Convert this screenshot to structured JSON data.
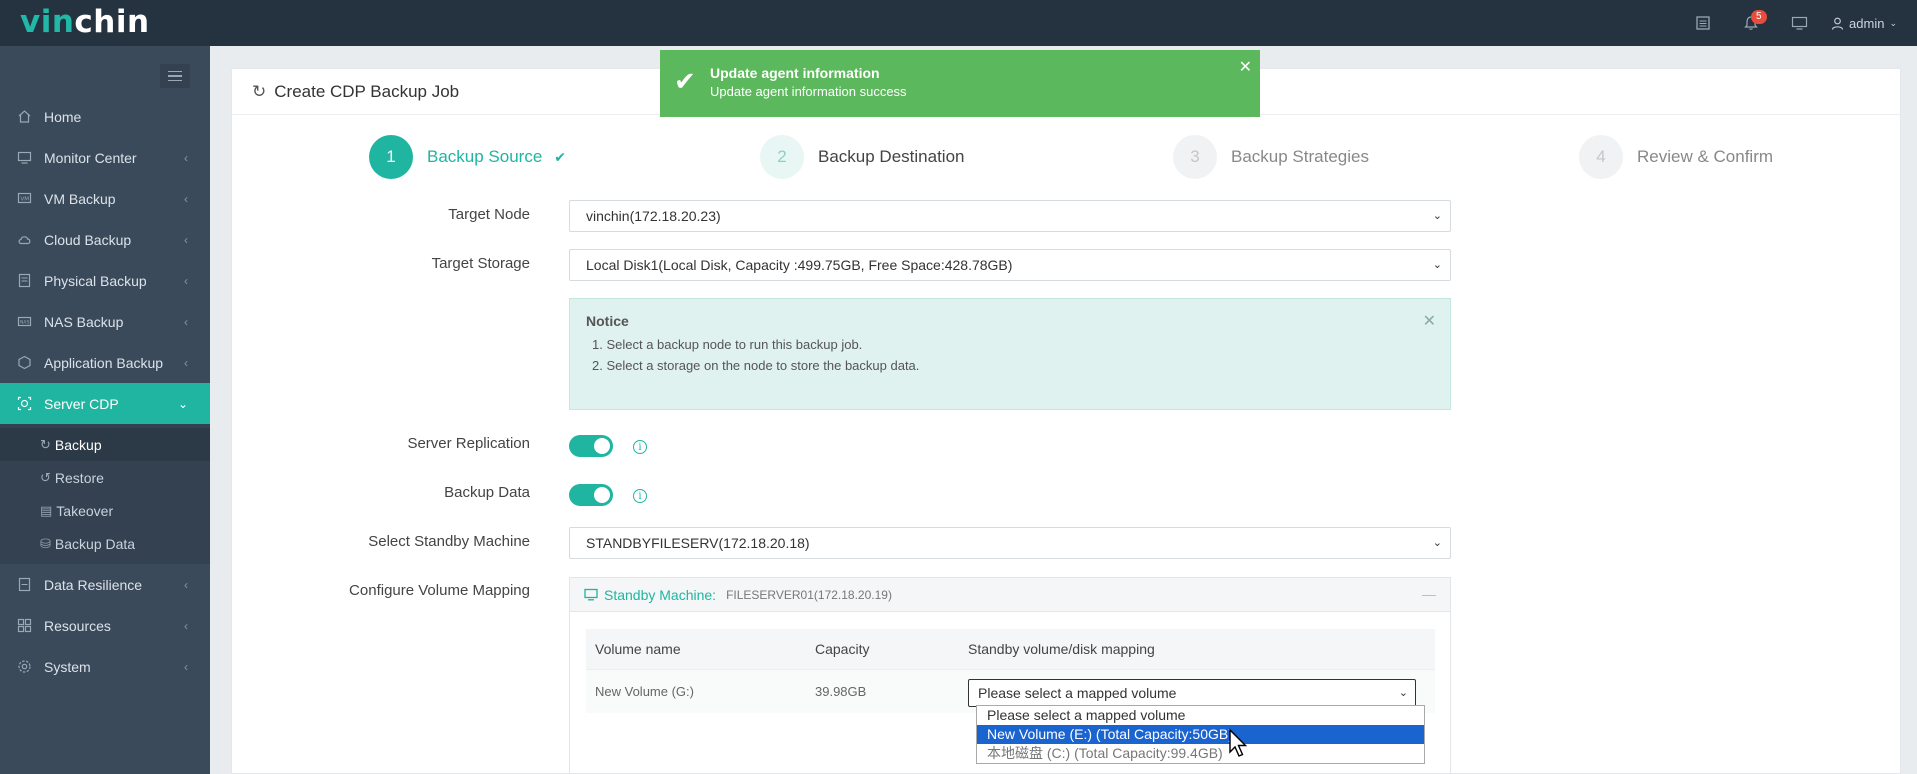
{
  "app": {
    "logo_prefix": "vin",
    "logo_suffix": "chin",
    "notification_count": "5",
    "user": "admin"
  },
  "sidebar": {
    "items": [
      {
        "label": "Home",
        "icon": "home-icon"
      },
      {
        "label": "Monitor Center",
        "icon": "monitor-icon"
      },
      {
        "label": "VM Backup",
        "icon": "vm-icon"
      },
      {
        "label": "Cloud Backup",
        "icon": "cloud-icon"
      },
      {
        "label": "Physical Backup",
        "icon": "physical-icon"
      },
      {
        "label": "NAS Backup",
        "icon": "nas-icon"
      },
      {
        "label": "Application Backup",
        "icon": "app-icon"
      },
      {
        "label": "Server CDP",
        "icon": "cdp-icon"
      },
      {
        "label": "Data Resilience",
        "icon": "resilience-icon"
      },
      {
        "label": "Resources",
        "icon": "resources-icon"
      },
      {
        "label": "System",
        "icon": "gear-icon"
      }
    ],
    "submenu": [
      {
        "label": "Backup"
      },
      {
        "label": "Restore"
      },
      {
        "label": "Takeover"
      },
      {
        "label": "Backup Data"
      }
    ]
  },
  "page": {
    "title": "Create CDP Backup Job"
  },
  "steps": [
    {
      "num": "1",
      "label": "Backup Source",
      "state": "done"
    },
    {
      "num": "2",
      "label": "Backup Destination",
      "state": "next"
    },
    {
      "num": "3",
      "label": "Backup Strategies",
      "state": "pending"
    },
    {
      "num": "4",
      "label": "Review & Confirm",
      "state": "pending"
    }
  ],
  "form": {
    "target_node_label": "Target Node",
    "target_node_value": "vinchin(172.18.20.23)",
    "target_storage_label": "Target Storage",
    "target_storage_value": "Local Disk1(Local Disk, Capacity :499.75GB, Free Space:428.78GB)",
    "notice_title": "Notice",
    "notice_lines": [
      "1. Select a backup node to run this backup job.",
      "2. Select a storage on the node to store the backup data."
    ],
    "server_replication_label": "Server Replication",
    "server_replication_on": true,
    "backup_data_label": "Backup Data",
    "backup_data_on": true,
    "standby_label": "Select Standby Machine",
    "standby_value": "STANDBYFILESERV(172.18.20.18)",
    "volume_mapping_label": "Configure Volume Mapping"
  },
  "volume_box": {
    "standby_prefix": "Standby Machine:",
    "host": "FILESERVER01(172.18.20.19)",
    "columns": [
      "Volume name",
      "Capacity",
      "Standby volume/disk mapping"
    ],
    "rows": [
      {
        "volume": "New Volume (G:)",
        "capacity": "39.98GB",
        "mapping": "Please select a mapped volume"
      }
    ]
  },
  "dropdown": {
    "options": [
      "Please select a mapped volume",
      "New Volume (E:) (Total Capacity:50GB)",
      "本地磁盘 (C:) (Total Capacity:99.4GB)"
    ],
    "highlighted_index": 1
  },
  "toast": {
    "title": "Update agent information",
    "message": "Update agent information success"
  },
  "colors": {
    "accent": "#1fb5a0",
    "topbar": "#253341",
    "sidebar": "#3b4a5a",
    "toast": "#5cb85c",
    "highlight": "#1a64d0"
  }
}
